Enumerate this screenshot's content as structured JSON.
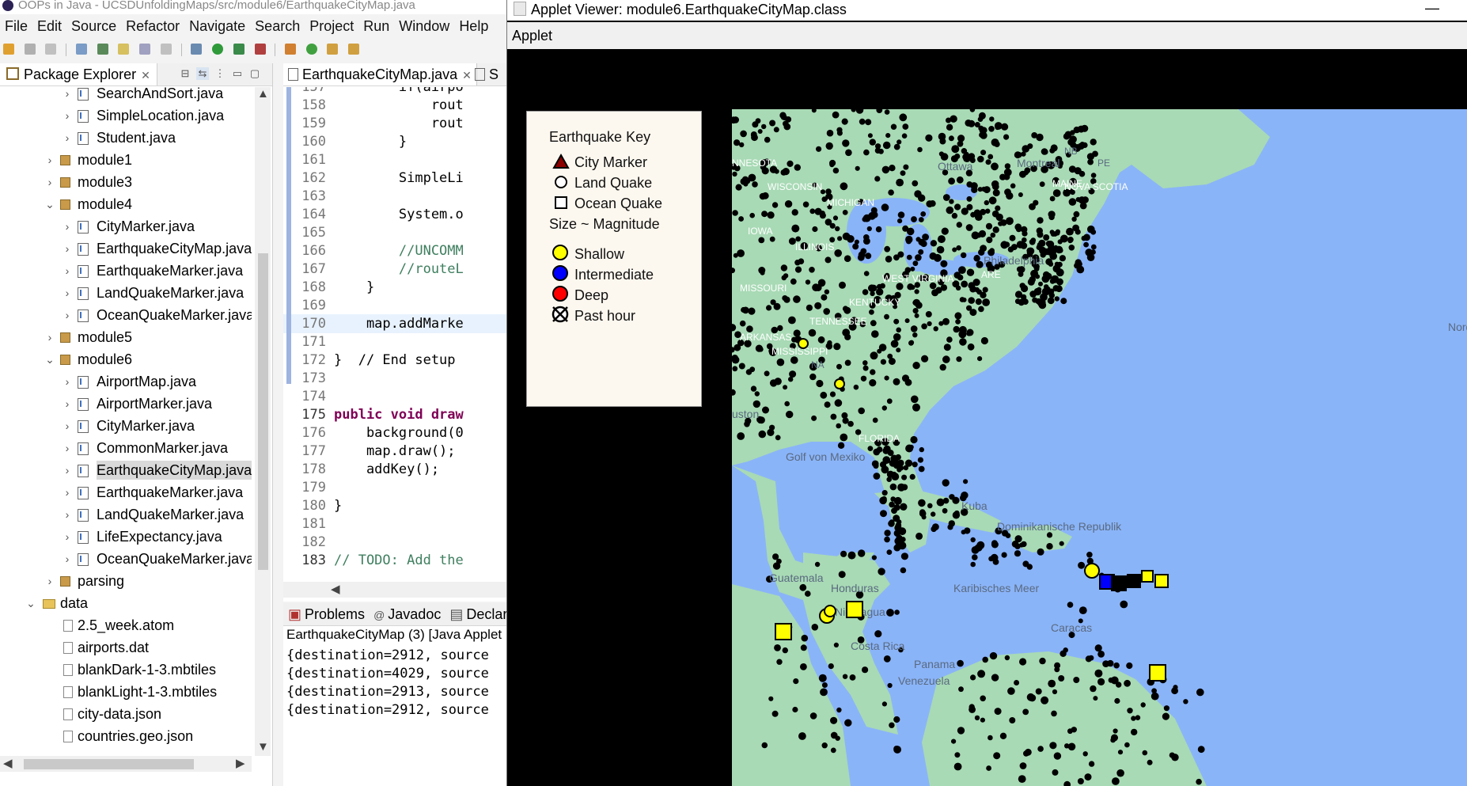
{
  "eclipse": {
    "title": "OOPs in Java - UCSDUnfoldingMaps/src/module6/EarthquakeCityMap.java",
    "menu": [
      "File",
      "Edit",
      "Source",
      "Refactor",
      "Navigate",
      "Search",
      "Project",
      "Run",
      "Window",
      "Help"
    ],
    "package_explorer": {
      "tab_label": "Package Explorer",
      "tree": [
        {
          "label": "SearchAndSort.java",
          "type": "java"
        },
        {
          "label": "SimpleLocation.java",
          "type": "java"
        },
        {
          "label": "Student.java",
          "type": "java"
        },
        {
          "label": "module1",
          "type": "package"
        },
        {
          "label": "module3",
          "type": "package"
        },
        {
          "label": "module4",
          "type": "package"
        },
        {
          "label": "CityMarker.java",
          "type": "java"
        },
        {
          "label": "EarthquakeCityMap.java",
          "type": "java"
        },
        {
          "label": "EarthquakeMarker.java",
          "type": "java"
        },
        {
          "label": "LandQuakeMarker.java",
          "type": "java"
        },
        {
          "label": "OceanQuakeMarker.java",
          "type": "java"
        },
        {
          "label": "module5",
          "type": "package"
        },
        {
          "label": "module6",
          "type": "package"
        },
        {
          "label": "AirportMap.java",
          "type": "java"
        },
        {
          "label": "AirportMarker.java",
          "type": "java"
        },
        {
          "label": "CityMarker.java",
          "type": "java"
        },
        {
          "label": "CommonMarker.java",
          "type": "java"
        },
        {
          "label": "EarthquakeCityMap.java",
          "type": "java",
          "selected": true
        },
        {
          "label": "EarthquakeMarker.java",
          "type": "java"
        },
        {
          "label": "LandQuakeMarker.java",
          "type": "java"
        },
        {
          "label": "LifeExpectancy.java",
          "type": "java"
        },
        {
          "label": "OceanQuakeMarker.java",
          "type": "java"
        },
        {
          "label": "parsing",
          "type": "package"
        },
        {
          "label": "data",
          "type": "folder"
        },
        {
          "label": "2.5_week.atom",
          "type": "file"
        },
        {
          "label": "airports.dat",
          "type": "file"
        },
        {
          "label": "blankDark-1-3.mbtiles",
          "type": "file"
        },
        {
          "label": "blankLight-1-3.mbtiles",
          "type": "file"
        },
        {
          "label": "city-data.json",
          "type": "file"
        },
        {
          "label": "countries.geo.json",
          "type": "file"
        }
      ]
    },
    "editor": {
      "tabs": [
        "EarthquakeCityMap.java",
        "S"
      ],
      "lines": [
        {
          "n": "157",
          "code": "        if(airpo"
        },
        {
          "n": "158",
          "code": "            rout"
        },
        {
          "n": "159",
          "code": "            rout"
        },
        {
          "n": "160",
          "code": "        }"
        },
        {
          "n": "161",
          "code": ""
        },
        {
          "n": "162",
          "code": "        SimpleLi"
        },
        {
          "n": "163",
          "code": ""
        },
        {
          "n": "164",
          "code": "        System.o"
        },
        {
          "n": "165",
          "code": ""
        },
        {
          "n": "166",
          "code": "        //UNCOMM"
        },
        {
          "n": "167",
          "code": "        //routeL"
        },
        {
          "n": "168",
          "code": "    }"
        },
        {
          "n": "169",
          "code": ""
        },
        {
          "n": "170",
          "code": "    map.addMarke"
        },
        {
          "n": "171",
          "code": ""
        },
        {
          "n": "172",
          "code": "}  // End setup"
        },
        {
          "n": "173",
          "code": ""
        },
        {
          "n": "174",
          "code": ""
        },
        {
          "n": "175",
          "code": "public void draw"
        },
        {
          "n": "176",
          "code": "    background(0"
        },
        {
          "n": "177",
          "code": "    map.draw();"
        },
        {
          "n": "178",
          "code": "    addKey();"
        },
        {
          "n": "179",
          "code": ""
        },
        {
          "n": "180",
          "code": "}"
        },
        {
          "n": "181",
          "code": ""
        },
        {
          "n": "182",
          "code": ""
        },
        {
          "n": "183",
          "code": "// TODO: Add the"
        }
      ]
    },
    "console": {
      "tabs": [
        "Problems",
        "Javadoc",
        "Declara"
      ],
      "header": "EarthquakeCityMap (3) [Java Applet",
      "lines": [
        "{destination=2912, source",
        "{destination=4029, source",
        "{destination=2913, source",
        "{destination=2912, source"
      ]
    }
  },
  "applet": {
    "title": "Applet Viewer: module6.EarthquakeCityMap.class",
    "minimize": "—",
    "menu": "Applet",
    "legend": {
      "title": "Earthquake Key",
      "city_marker": "City Marker",
      "land_quake": "Land Quake",
      "ocean_quake": "Ocean Quake",
      "size_label": "Size ~ Magnitude",
      "shallow": "Shallow",
      "intermediate": "Intermediate",
      "deep": "Deep",
      "past_hour": "Past hour",
      "colors": {
        "shallow": "#ffff00",
        "intermediate": "#0000ff",
        "deep": "#ff0000",
        "city": "#8b0000"
      }
    },
    "map": {
      "ocean_color": "#8ab4f8",
      "land_color": "#a8dab5",
      "labels": [
        "NNESOTA",
        "Ottawa",
        "Montreal",
        "NB",
        "PE",
        "WISCONSIN",
        "MAINE",
        "NOVA SCOTIA",
        "MICHIGAN",
        "IOWA",
        "ILLINOIS",
        "Philadelphia",
        "MISSOURI",
        "WEST VIRGINIA",
        "ARE",
        "KENTUCKY",
        "TENNESSEE",
        "ARKANSAS",
        "MISSISSIPPI",
        "NA",
        "uston",
        "FLORIDA",
        "Golf von Mexiko",
        "Kuba",
        "Dominikanische Republik",
        "Guatemala",
        "Honduras",
        "Nicaragua",
        "Karibisches Meer",
        "Caracas",
        "Costa Rica",
        "Panama",
        "Venezuela",
        "Nordatlantik"
      ]
    }
  }
}
